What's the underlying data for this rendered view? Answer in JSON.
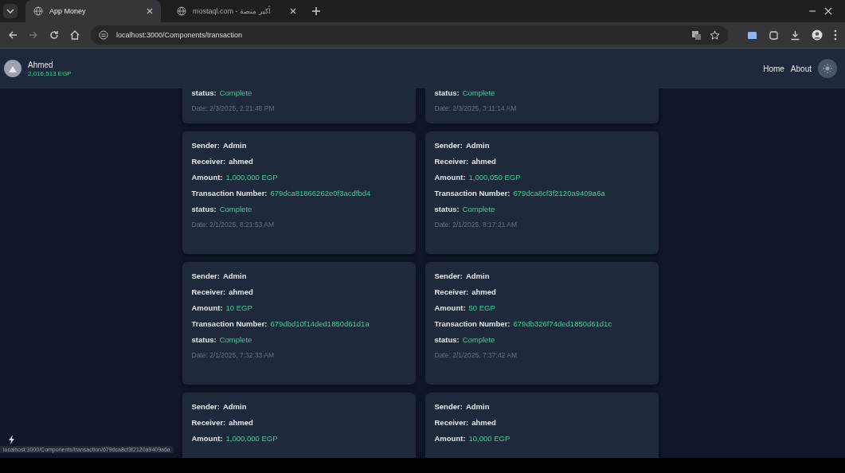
{
  "browser": {
    "tabs": [
      {
        "title": "App Money",
        "selected": true
      },
      {
        "title": "mostaql.com - أكبر منصة",
        "selected": false
      }
    ],
    "url": "localhost:3000/Components/transaction",
    "status_url": "localhost:3000/Components/transaction/679dca8cf3f2120a9409a6a"
  },
  "header": {
    "user": "Ahmed",
    "balance": "2,016,513 EGP",
    "nav": [
      "Home",
      "About"
    ]
  },
  "cards": [
    {
      "fields": [
        {
          "label": "status:",
          "value": "Complete",
          "kind": "accent"
        }
      ],
      "date": "Date: 2/3/2025, 2:21:48 PM"
    },
    {
      "fields": [
        {
          "label": "status:",
          "value": "Complete",
          "kind": "accent"
        }
      ],
      "date": "Date: 2/3/2025, 3:11:14 AM"
    },
    {
      "fields": [
        {
          "label": "Sender:",
          "value": "Admin",
          "kind": "plain"
        },
        {
          "label": "Receiver:",
          "value": "ahmed",
          "kind": "plain"
        },
        {
          "label": "Amount:",
          "value": "1,000,000 EGP",
          "kind": "accent"
        },
        {
          "label": "Transaction Number:",
          "value": "679dca81866262e0f3acdfbd4",
          "kind": "accent"
        },
        {
          "label": "status:",
          "value": "Complete",
          "kind": "accent"
        }
      ],
      "date": "Date: 2/1/2025, 8:21:53 AM"
    },
    {
      "fields": [
        {
          "label": "Sender:",
          "value": "Admin",
          "kind": "plain"
        },
        {
          "label": "Receiver:",
          "value": "ahmed",
          "kind": "plain"
        },
        {
          "label": "Amount:",
          "value": "1,000,050 EGP",
          "kind": "accent"
        },
        {
          "label": "Transaction Number:",
          "value": "679dca8cf3f2120a9409a6a",
          "kind": "accent"
        },
        {
          "label": "status:",
          "value": "Complete",
          "kind": "accent"
        }
      ],
      "date": "Date: 2/1/2025, 8:17:21 AM"
    },
    {
      "fields": [
        {
          "label": "Sender:",
          "value": "Admin",
          "kind": "plain"
        },
        {
          "label": "Receiver:",
          "value": "ahmed",
          "kind": "plain"
        },
        {
          "label": "Amount:",
          "value": "10 EGP",
          "kind": "accent"
        },
        {
          "label": "Transaction Number:",
          "value": "679dbd10f14ded1850d61d1a",
          "kind": "accent"
        },
        {
          "label": "status:",
          "value": "Complete",
          "kind": "accent"
        }
      ],
      "date": "Date: 2/1/2025, 7:32:33 AM"
    },
    {
      "fields": [
        {
          "label": "Sender:",
          "value": "Admin",
          "kind": "plain"
        },
        {
          "label": "Receiver:",
          "value": "ahmed",
          "kind": "plain"
        },
        {
          "label": "Amount:",
          "value": "50 EGP",
          "kind": "accent"
        },
        {
          "label": "Transaction Number:",
          "value": "679db326f74ded1850d61d1c",
          "kind": "accent"
        },
        {
          "label": "status:",
          "value": "Complete",
          "kind": "accent"
        }
      ],
      "date": "Date: 2/1/2025, 7:37:42 AM"
    },
    {
      "fields": [
        {
          "label": "Sender:",
          "value": "Admin",
          "kind": "plain"
        },
        {
          "label": "Receiver:",
          "value": "ahmed",
          "kind": "plain"
        },
        {
          "label": "Amount:",
          "value": "1,000,000 EGP",
          "kind": "accent"
        }
      ]
    },
    {
      "fields": [
        {
          "label": "Sender:",
          "value": "Admin",
          "kind": "plain"
        },
        {
          "label": "Receiver:",
          "value": "ahmed",
          "kind": "plain"
        },
        {
          "label": "Amount:",
          "value": "10,000 EGP",
          "kind": "accent"
        }
      ]
    }
  ]
}
